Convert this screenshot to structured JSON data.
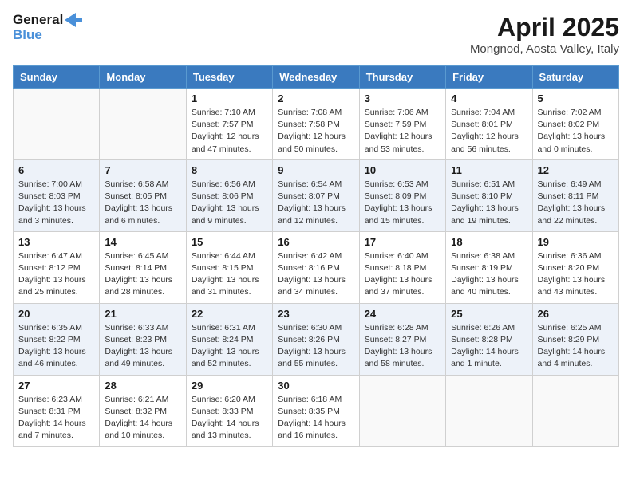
{
  "header": {
    "logo_line1": "General",
    "logo_line2": "Blue",
    "month_title": "April 2025",
    "location": "Mongnod, Aosta Valley, Italy"
  },
  "days_of_week": [
    "Sunday",
    "Monday",
    "Tuesday",
    "Wednesday",
    "Thursday",
    "Friday",
    "Saturday"
  ],
  "weeks": [
    {
      "days": [
        {
          "num": "",
          "info": ""
        },
        {
          "num": "",
          "info": ""
        },
        {
          "num": "1",
          "info": "Sunrise: 7:10 AM\nSunset: 7:57 PM\nDaylight: 12 hours and 47 minutes."
        },
        {
          "num": "2",
          "info": "Sunrise: 7:08 AM\nSunset: 7:58 PM\nDaylight: 12 hours and 50 minutes."
        },
        {
          "num": "3",
          "info": "Sunrise: 7:06 AM\nSunset: 7:59 PM\nDaylight: 12 hours and 53 minutes."
        },
        {
          "num": "4",
          "info": "Sunrise: 7:04 AM\nSunset: 8:01 PM\nDaylight: 12 hours and 56 minutes."
        },
        {
          "num": "5",
          "info": "Sunrise: 7:02 AM\nSunset: 8:02 PM\nDaylight: 13 hours and 0 minutes."
        }
      ]
    },
    {
      "days": [
        {
          "num": "6",
          "info": "Sunrise: 7:00 AM\nSunset: 8:03 PM\nDaylight: 13 hours and 3 minutes."
        },
        {
          "num": "7",
          "info": "Sunrise: 6:58 AM\nSunset: 8:05 PM\nDaylight: 13 hours and 6 minutes."
        },
        {
          "num": "8",
          "info": "Sunrise: 6:56 AM\nSunset: 8:06 PM\nDaylight: 13 hours and 9 minutes."
        },
        {
          "num": "9",
          "info": "Sunrise: 6:54 AM\nSunset: 8:07 PM\nDaylight: 13 hours and 12 minutes."
        },
        {
          "num": "10",
          "info": "Sunrise: 6:53 AM\nSunset: 8:09 PM\nDaylight: 13 hours and 15 minutes."
        },
        {
          "num": "11",
          "info": "Sunrise: 6:51 AM\nSunset: 8:10 PM\nDaylight: 13 hours and 19 minutes."
        },
        {
          "num": "12",
          "info": "Sunrise: 6:49 AM\nSunset: 8:11 PM\nDaylight: 13 hours and 22 minutes."
        }
      ]
    },
    {
      "days": [
        {
          "num": "13",
          "info": "Sunrise: 6:47 AM\nSunset: 8:12 PM\nDaylight: 13 hours and 25 minutes."
        },
        {
          "num": "14",
          "info": "Sunrise: 6:45 AM\nSunset: 8:14 PM\nDaylight: 13 hours and 28 minutes."
        },
        {
          "num": "15",
          "info": "Sunrise: 6:44 AM\nSunset: 8:15 PM\nDaylight: 13 hours and 31 minutes."
        },
        {
          "num": "16",
          "info": "Sunrise: 6:42 AM\nSunset: 8:16 PM\nDaylight: 13 hours and 34 minutes."
        },
        {
          "num": "17",
          "info": "Sunrise: 6:40 AM\nSunset: 8:18 PM\nDaylight: 13 hours and 37 minutes."
        },
        {
          "num": "18",
          "info": "Sunrise: 6:38 AM\nSunset: 8:19 PM\nDaylight: 13 hours and 40 minutes."
        },
        {
          "num": "19",
          "info": "Sunrise: 6:36 AM\nSunset: 8:20 PM\nDaylight: 13 hours and 43 minutes."
        }
      ]
    },
    {
      "days": [
        {
          "num": "20",
          "info": "Sunrise: 6:35 AM\nSunset: 8:22 PM\nDaylight: 13 hours and 46 minutes."
        },
        {
          "num": "21",
          "info": "Sunrise: 6:33 AM\nSunset: 8:23 PM\nDaylight: 13 hours and 49 minutes."
        },
        {
          "num": "22",
          "info": "Sunrise: 6:31 AM\nSunset: 8:24 PM\nDaylight: 13 hours and 52 minutes."
        },
        {
          "num": "23",
          "info": "Sunrise: 6:30 AM\nSunset: 8:26 PM\nDaylight: 13 hours and 55 minutes."
        },
        {
          "num": "24",
          "info": "Sunrise: 6:28 AM\nSunset: 8:27 PM\nDaylight: 13 hours and 58 minutes."
        },
        {
          "num": "25",
          "info": "Sunrise: 6:26 AM\nSunset: 8:28 PM\nDaylight: 14 hours and 1 minute."
        },
        {
          "num": "26",
          "info": "Sunrise: 6:25 AM\nSunset: 8:29 PM\nDaylight: 14 hours and 4 minutes."
        }
      ]
    },
    {
      "days": [
        {
          "num": "27",
          "info": "Sunrise: 6:23 AM\nSunset: 8:31 PM\nDaylight: 14 hours and 7 minutes."
        },
        {
          "num": "28",
          "info": "Sunrise: 6:21 AM\nSunset: 8:32 PM\nDaylight: 14 hours and 10 minutes."
        },
        {
          "num": "29",
          "info": "Sunrise: 6:20 AM\nSunset: 8:33 PM\nDaylight: 14 hours and 13 minutes."
        },
        {
          "num": "30",
          "info": "Sunrise: 6:18 AM\nSunset: 8:35 PM\nDaylight: 14 hours and 16 minutes."
        },
        {
          "num": "",
          "info": ""
        },
        {
          "num": "",
          "info": ""
        },
        {
          "num": "",
          "info": ""
        }
      ]
    }
  ]
}
